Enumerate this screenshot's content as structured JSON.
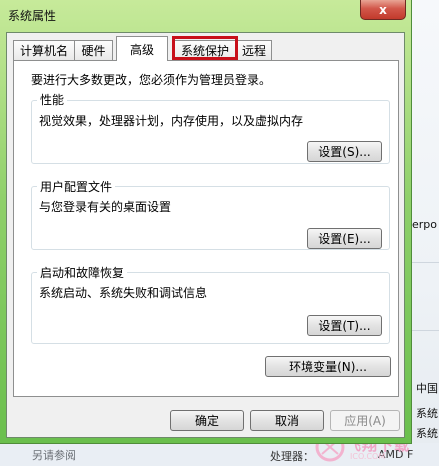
{
  "window": {
    "title": "系统属性",
    "close_symbol": "x"
  },
  "tabs": [
    {
      "label": "计算机名"
    },
    {
      "label": "硬件"
    },
    {
      "label": "高级",
      "active": true
    },
    {
      "label": "系统保护",
      "highlighted": true
    },
    {
      "label": "远程"
    }
  ],
  "admin_note": "要进行大多数更改，您必须作为管理员登录。",
  "performance": {
    "title": "性能",
    "description": "视觉效果，处理器计划，内存使用，以及虚拟内存",
    "button": "设置(S)..."
  },
  "user_profiles": {
    "title": "用户配置文件",
    "description": "与您登录有关的桌面设置",
    "button": "设置(E)..."
  },
  "startup_recovery": {
    "title": "启动和故障恢复",
    "description": "系统启动、系统失败和调试信息",
    "button": "设置(T)..."
  },
  "env_button": "环境变量(N)...",
  "footer": {
    "ok": "确定",
    "cancel": "取消",
    "apply": "应用(A)"
  },
  "background": {
    "right_texts": [
      "erpo",
      "中国",
      "系统",
      "系统"
    ],
    "bottom_left": "另请参阅",
    "cpu_label": "处理器：",
    "cpu_value": "AMD F",
    "watermark": "飞翔下载",
    "watermark_sub": "ICO.COM"
  },
  "colors": {
    "highlight_border": "#c8101a",
    "window_frame": "#8fd06a"
  }
}
